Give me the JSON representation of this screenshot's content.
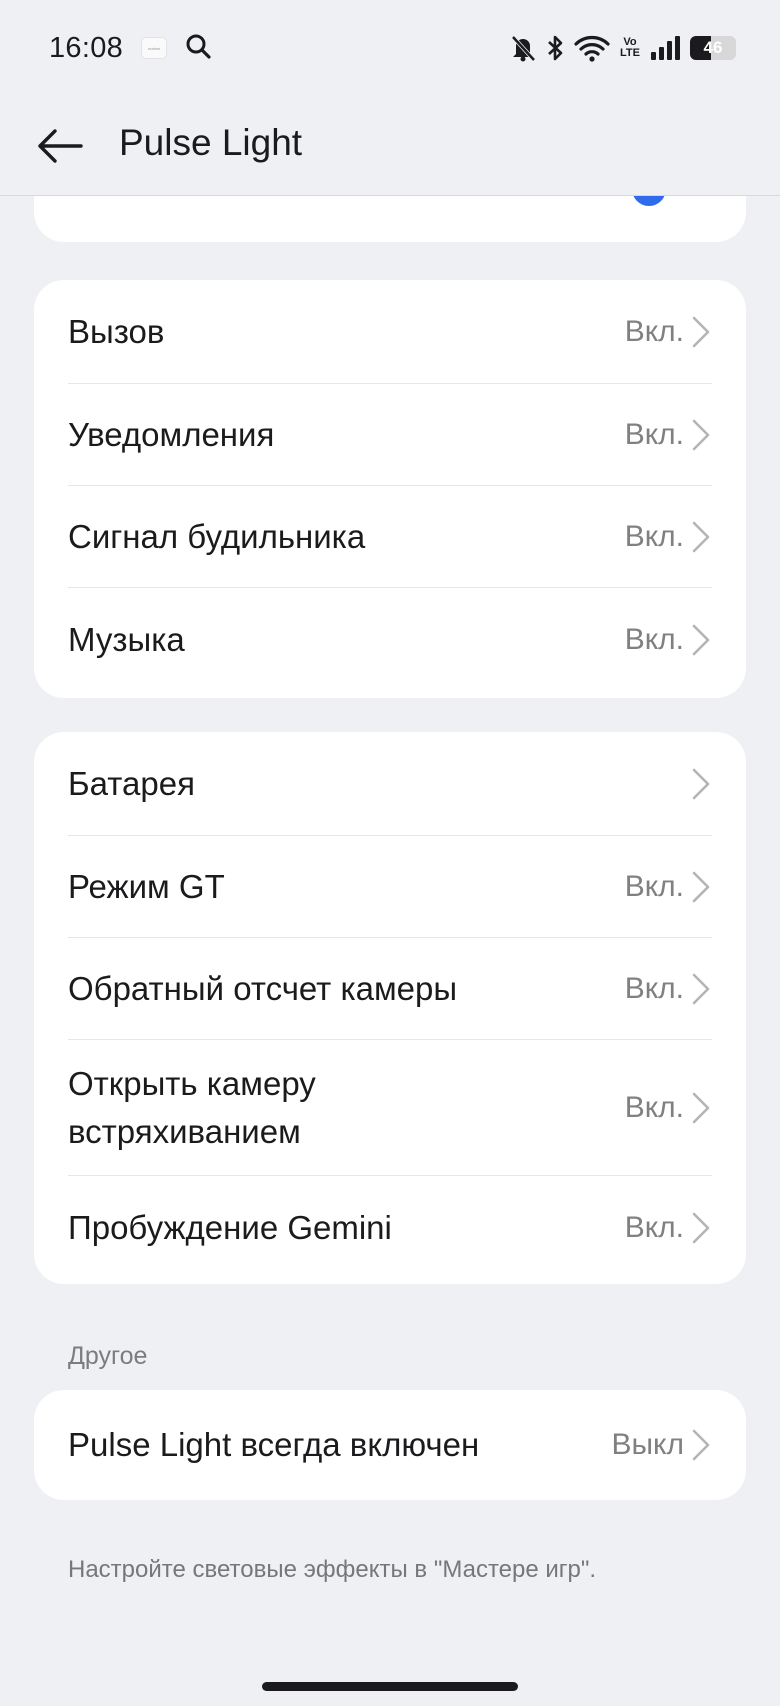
{
  "status_bar": {
    "time": "16:08",
    "app_thumbnail": "realme",
    "battery_level": "46",
    "battery_fraction": 0.46,
    "volte_top": "Vo",
    "volte_bottom": "LTE",
    "icons": [
      "search-icon",
      "mute-bell-icon",
      "bluetooth-icon",
      "wifi-icon",
      "volte-icon",
      "signal-icon",
      "battery-icon"
    ]
  },
  "top_bar": {
    "title": "Pulse Light",
    "back_icon": "arrow-left-icon"
  },
  "groups": [
    {
      "items": [
        {
          "label": "Вызов",
          "value": "Вкл."
        },
        {
          "label": "Уведомления",
          "value": "Вкл."
        },
        {
          "label": "Сигнал будильника",
          "value": "Вкл."
        },
        {
          "label": "Музыка",
          "value": "Вкл."
        }
      ]
    },
    {
      "items": [
        {
          "label": "Батарея",
          "value": ""
        },
        {
          "label": "Режим GT",
          "value": "Вкл."
        },
        {
          "label": "Обратный отсчет камеры",
          "value": "Вкл."
        },
        {
          "label_line1": "Открыть камеру",
          "label_line2": "встряхиванием",
          "value": "Вкл."
        },
        {
          "label": "Пробуждение Gemini",
          "value": "Вкл."
        }
      ]
    }
  ],
  "other_section": {
    "header": "Другое",
    "items": [
      {
        "label": "Pulse Light всегда включен",
        "value": "Выкл"
      }
    ]
  },
  "footer_note": "Настройте световые эффекты в \"Мастере игр\".",
  "colors": {
    "background": "#eff0f3",
    "card": "#ffffff",
    "accent": "#2f6bec",
    "secondary_text": "#808083"
  }
}
